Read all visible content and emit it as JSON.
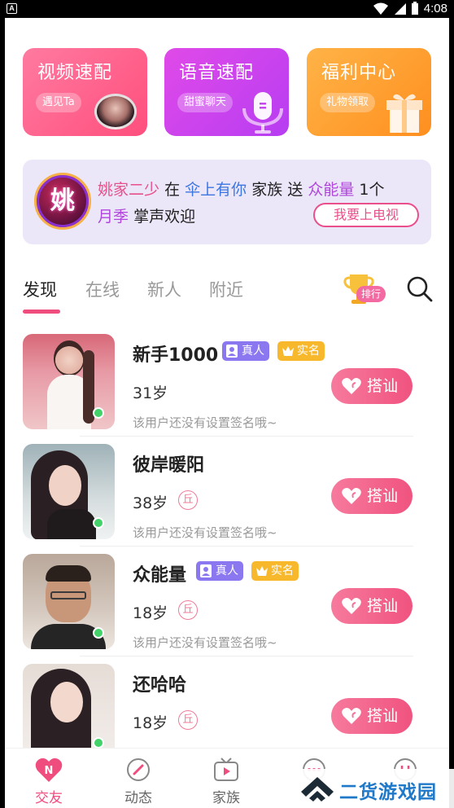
{
  "status_bar": {
    "app_icon_letter": "A",
    "time": "4:08"
  },
  "cards": [
    {
      "title": "视频速配",
      "pill": "遇见Ta"
    },
    {
      "title": "语音速配",
      "pill": "甜蜜聊天"
    },
    {
      "title": "福利中心",
      "pill": "礼物领取"
    }
  ],
  "notice": {
    "badge_char": "姚",
    "sender": "姚家二少",
    "word_in": "在",
    "family": "伞上有你",
    "word_family": "家族",
    "word_send": "送",
    "gift": "众能量",
    "count": "1个",
    "gift2": "月季",
    "applause": "掌声欢迎",
    "button": "我要上电视"
  },
  "tabs": [
    "发现",
    "在线",
    "新人",
    "附近"
  ],
  "rank_label": "排行",
  "users": [
    {
      "name": "新手1000",
      "age": "31岁",
      "tags": [
        "真人",
        "实名"
      ],
      "level": "",
      "sign": "该用户还没有设置签名哦~",
      "greet": "搭讪"
    },
    {
      "name": "彼岸暖阳",
      "age": "38岁",
      "tags": [],
      "level": "丘",
      "sign": "该用户还没有设置签名哦~",
      "greet": "搭讪"
    },
    {
      "name": "众能量",
      "age": "18岁",
      "tags": [
        "真人",
        "实名"
      ],
      "level": "丘",
      "sign": "该用户还没有设置签名哦~",
      "greet": "搭讪"
    },
    {
      "name": "还哈哈",
      "age": "18岁",
      "tags": [],
      "level": "丘",
      "sign": "",
      "greet": "搭讪"
    }
  ],
  "nav": [
    {
      "label": "交友",
      "icon_letter": "N"
    },
    {
      "label": "动态"
    },
    {
      "label": "家族"
    }
  ],
  "watermark": "二货游戏园",
  "colors": {
    "accent": "#f04d7f",
    "online": "#43d16a"
  }
}
